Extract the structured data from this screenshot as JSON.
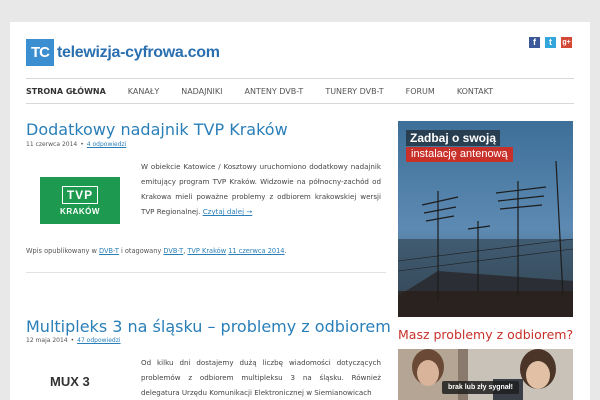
{
  "site": {
    "logo_abbr": "TC",
    "logo_text": "telewizja-cyfrowa.com",
    "brand_color": "#3b8fd0"
  },
  "social": [
    {
      "icon": "facebook-icon",
      "glyph": "f"
    },
    {
      "icon": "twitter-icon",
      "glyph": "t"
    },
    {
      "icon": "google-plus-icon",
      "glyph": "g+"
    }
  ],
  "nav": {
    "items": [
      "STRONA GŁÓWNA",
      "KANAŁY",
      "NADAJNIKI",
      "ANTENY DVB-T",
      "TUNERY DVB-T",
      "FORUM",
      "KONTAKT"
    ]
  },
  "posts": [
    {
      "title": "Dodatkowy nadajnik TVP Kraków",
      "date": "11 czerwca 2014",
      "comments": "4 odpowiedzi",
      "excerpt": "W obiekcie Katowice / Kosztowy uruchomiono dodatkowy nadajnik emitujący program TVP Kraków. Widzowie na północny-zachód od Krakowa mieli poważne problemy z odbiorem krakowskiej wersji TVP Regionalnej.",
      "read_more": "Czytaj dalej →",
      "footer_prefix": "Wpis opublikowany w",
      "category": "DVB-T",
      "tagged_text": "i otagowany",
      "tag1": "DVB-T",
      "tag2": "TVP Kraków",
      "footer_date": "11 czerwca 2014",
      "logo_main": "TVP",
      "logo_sub": "KRAKÓW"
    },
    {
      "title": "Multipleks 3 na śląsku – problemy z odbiorem",
      "date": "12 maja 2014",
      "comments": "47 odpowiedzi",
      "excerpt": "Od kilku dni dostajemy dużą liczbę wiadomości dotyczących problemów z odbiorem multipleksu 3 na śląsku. Również delegatura Urzędu Komunikacji Elektronicznej w Siemianowicach",
      "logo_main": "MUX",
      "logo_num": "3"
    }
  ],
  "sidebar": {
    "ad1_headline": "Zadbaj o swoją",
    "ad1_sub": "instalację antenową",
    "ad2_headline": "Masz problemy z odbiorem?",
    "ad2_bubble": "brak lub zły sygnał!"
  },
  "colors": {
    "link": "#2a7fb8",
    "accent_red": "#c8302a",
    "tvp_green": "#1d9a4f"
  }
}
